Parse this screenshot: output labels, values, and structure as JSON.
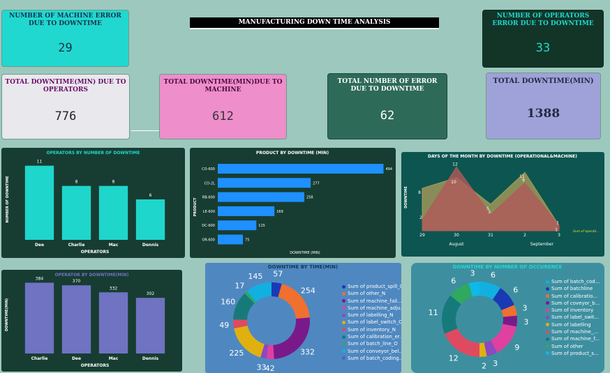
{
  "header": {
    "title": "MANUFACTURING DOWN TIME ANALYSIS"
  },
  "kpis": {
    "machine_errors": {
      "title": "NUMBER OF MACHINE ERROR DUE TO DOWNTIME",
      "value": "29"
    },
    "operator_errors": {
      "title": "NUMBER OF OPERATORS ERROR DUE TO DOWNTIME",
      "value": "33"
    },
    "downtime_operators": {
      "title": "TOTAL DOWNTIME(MIN) DUE TO OPERATORS",
      "value": "776"
    },
    "downtime_machine": {
      "title": "TOTAL DOWNTIME(MIN)DUE TO MACHINE",
      "value": "612"
    },
    "total_errors": {
      "title": "TOTAL NUMBER OF ERROR DUE TO DOWNTIME",
      "value": "62"
    },
    "total_downtime": {
      "title": "TOTAL DOWNTIME(MIN)",
      "value": "1388"
    }
  },
  "colors": {
    "teal": "#1fd6cc",
    "dark_green": "#173d32",
    "pink": "#ee8ecb",
    "lavender": "#9fa1d6",
    "bar_blue": "#1e90ff",
    "bar_purple": "#6f73c2"
  },
  "chart_data": [
    {
      "id": "operators_count",
      "type": "bar",
      "title": "OPERATORS BY NUMBER OF DOWNTIME",
      "xlabel": "OPERATORS",
      "ylabel": "NUMBER OF DOWNTIME",
      "categories": [
        "Dee",
        "Charlie",
        "Mac",
        "Dennis"
      ],
      "values": [
        11,
        8,
        8,
        6
      ],
      "ylim": [
        0,
        12
      ]
    },
    {
      "id": "product_downtime",
      "type": "bar",
      "orientation": "horizontal",
      "title": "PRODUCT BY DOWNTIME (MIN)",
      "xlabel": "DOWNTIME (MIN)",
      "ylabel": "PRODUCT",
      "categories": [
        "CO-600",
        "CO-2L",
        "RB-600",
        "LE-600",
        "DC-600",
        "OR-600"
      ],
      "values": [
        494,
        277,
        258,
        169,
        115,
        75
      ],
      "xlim": [
        0,
        520
      ]
    },
    {
      "id": "days_downtime",
      "type": "area",
      "title": "DAYS OF THE MONTH BY DOWNTIME (OPERATIONAL&MACHINE)",
      "ylabel": "DOWNTIME",
      "x": [
        "29",
        "30",
        "31",
        "2",
        "3"
      ],
      "month_labels": [
        "August",
        "September"
      ],
      "series": [
        {
          "name": "Sum of operati...",
          "values": [
            8,
            10,
            5,
            11,
            1
          ],
          "color": "#a89a5a"
        },
        {
          "values": [
            2,
            12,
            3,
            9,
            1
          ],
          "color": "#b05a5a"
        }
      ],
      "ylim": [
        0,
        13
      ]
    },
    {
      "id": "operator_downtime",
      "type": "bar",
      "title": "OPERATOR BY DOWNTIME(MIN)",
      "xlabel": "OPERATORS",
      "ylabel": "DOWNTIME(MIN)",
      "categories": [
        "Charlie",
        "Dee",
        "Mac",
        "Dennis"
      ],
      "values": [
        384,
        370,
        332,
        302
      ],
      "ylim": [
        0,
        420
      ]
    },
    {
      "id": "downtime_by_time",
      "type": "pie",
      "title": "DOWNTIME BY TIME(MIN)",
      "slices": [
        {
          "name": "Sum of product_spill_O",
          "value": 57,
          "color": "#1a3ab5"
        },
        {
          "name": "Sum of other_N",
          "value": 254,
          "color": "#f07030"
        },
        {
          "name": "Sum of machine_fail...",
          "value": 332,
          "color": "#7a1a8a"
        },
        {
          "name": "Sum of machine_adju...",
          "value": 42,
          "color": "#e040a0"
        },
        {
          "name": "Sum of labelling_N",
          "value": 33,
          "color": "#8a4ac0"
        },
        {
          "name": "Sum of label_switch_O",
          "value": 225,
          "color": "#e0b010"
        },
        {
          "name": "Sum of inventory_N",
          "value": 49,
          "color": "#e04a60"
        },
        {
          "name": "Sum of calibration_er...",
          "value": 160,
          "color": "#177a7a"
        },
        {
          "name": "Sum of batch_line_O",
          "value": 17,
          "color": "#30a860"
        },
        {
          "name": "Sum of conveyor_bel...",
          "value": 145,
          "color": "#12b0e0"
        },
        {
          "name": "Sum of batch_coding...",
          "value": 0,
          "color": "#4a60d0"
        }
      ]
    },
    {
      "id": "downtime_by_occurrence",
      "type": "pie",
      "title": "DOWNTIME BY NUMBER OF OCCURENCE",
      "slices": [
        {
          "name": "Sum of batch_cod...",
          "value": 6,
          "color": "#12b0e0"
        },
        {
          "name": "Sum of batchline",
          "value": 6,
          "color": "#1a3ab5"
        },
        {
          "name": "Sum of calibratio...",
          "value": 3,
          "color": "#f07030"
        },
        {
          "name": "Sum of coveyor_b...",
          "value": 3,
          "color": "#7a1a8a"
        },
        {
          "name": "Sum of inventory",
          "value": 9,
          "color": "#e040a0"
        },
        {
          "name": "Sum of label_swit...",
          "value": 3,
          "color": "#8a4ac0"
        },
        {
          "name": "Sum of labelling",
          "value": 2,
          "color": "#e0b010"
        },
        {
          "name": "Sum of machine_...",
          "value": 12,
          "color": "#e04a60"
        },
        {
          "name": "Sum of machine_f...",
          "value": 11,
          "color": "#177a7a"
        },
        {
          "name": "Sum of other",
          "value": 6,
          "color": "#30a860"
        },
        {
          "name": "Sum of product_s...",
          "value": 3,
          "color": "#0fb8e8"
        }
      ]
    }
  ]
}
